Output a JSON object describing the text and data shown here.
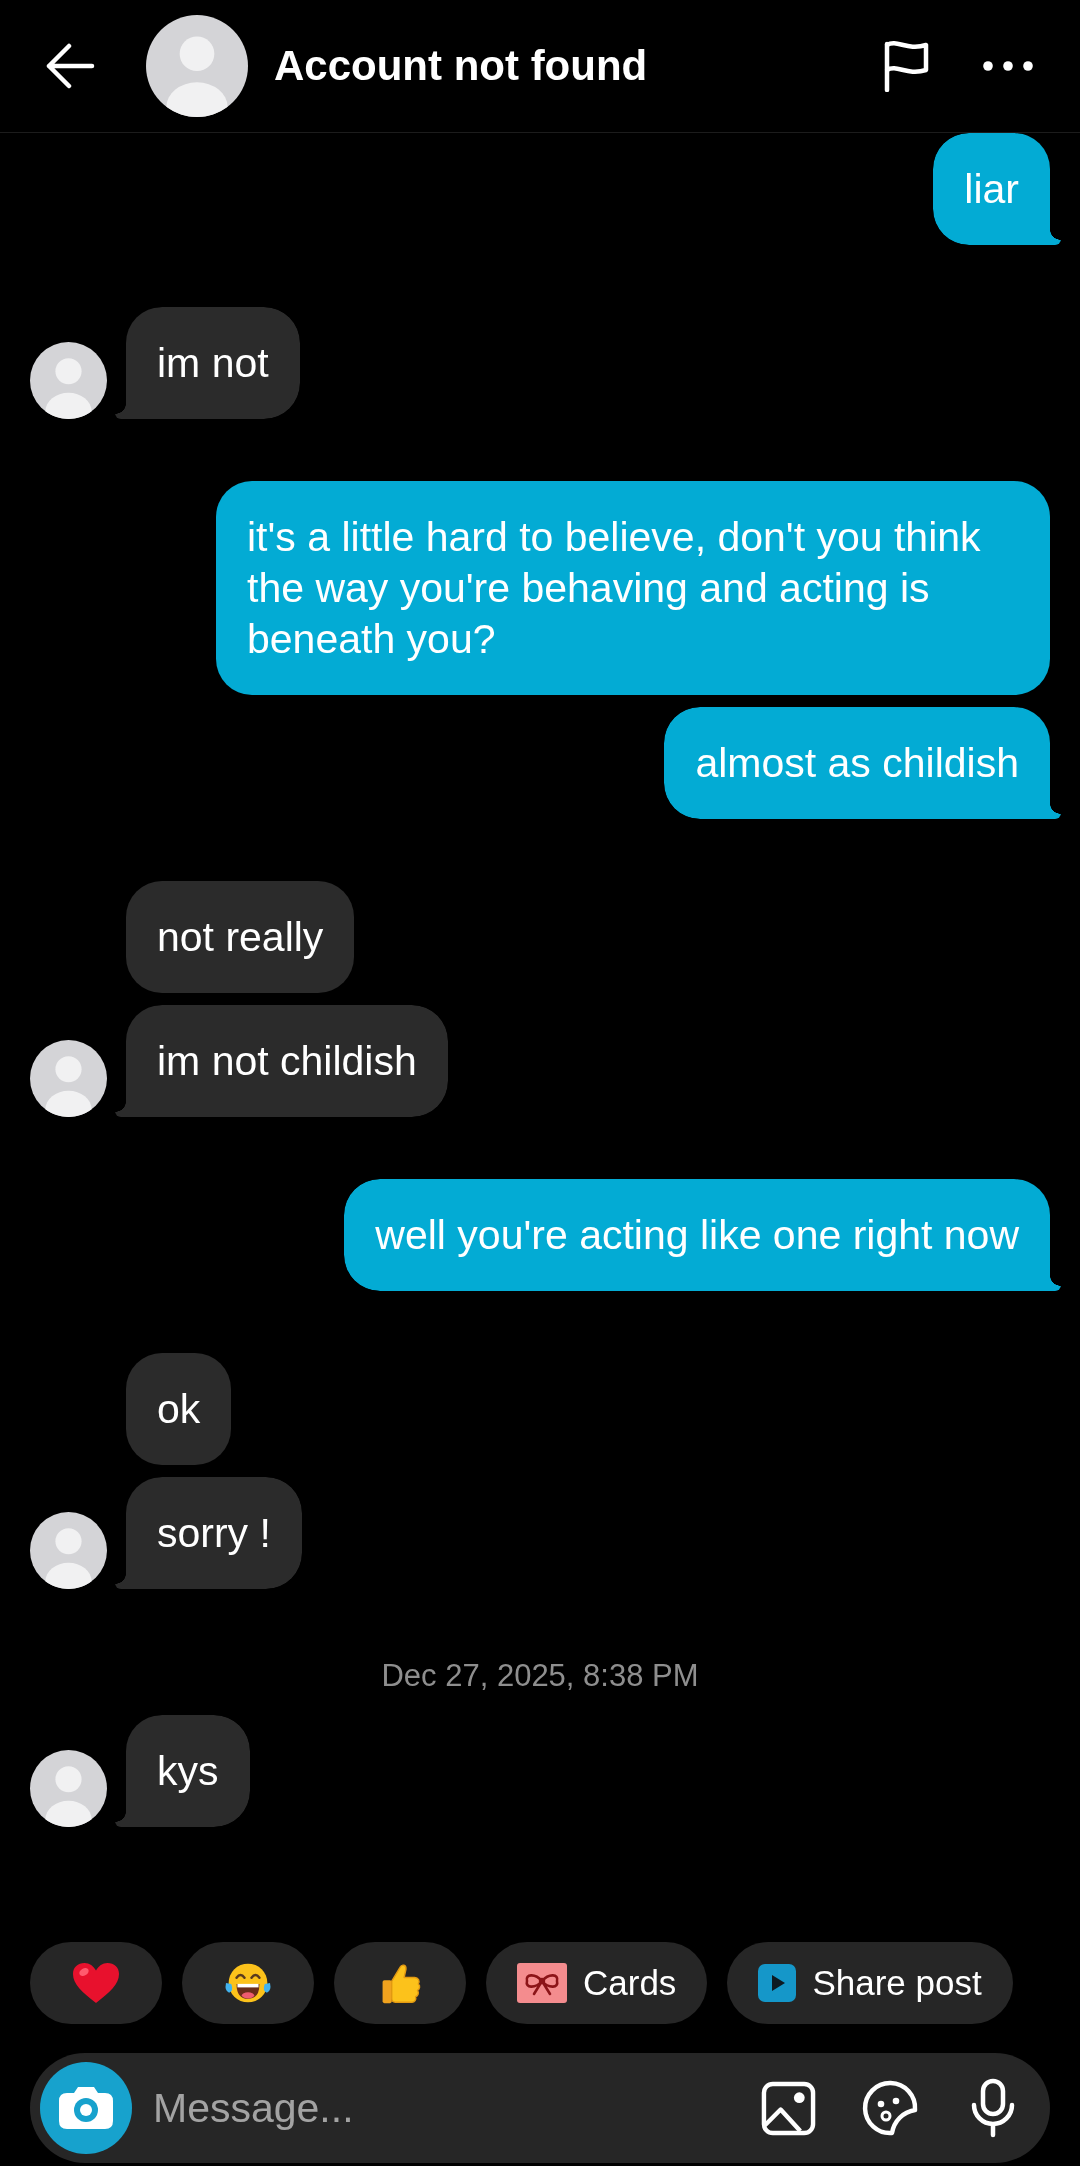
{
  "header": {
    "title": "Account not found"
  },
  "messages": [
    {
      "kind": "sent",
      "text": "liar"
    },
    {
      "kind": "received",
      "text": "im not"
    },
    {
      "kind": "sent",
      "text": "it's a little hard to believe, don't you think the way you're behaving and acting is beneath you?"
    },
    {
      "kind": "sent",
      "text": "almost as childish"
    },
    {
      "kind": "received",
      "text": "not really"
    },
    {
      "kind": "received",
      "text": "im not childish"
    },
    {
      "kind": "sent",
      "text": "well you're acting like one right now"
    },
    {
      "kind": "received",
      "text": "ok"
    },
    {
      "kind": "received",
      "text": "sorry !"
    },
    {
      "kind": "timestamp",
      "text": "Dec 27, 2025, 8:38 PM"
    },
    {
      "kind": "received",
      "text": "kys"
    }
  ],
  "quick_replies": [
    {
      "kind": "heart"
    },
    {
      "kind": "laughing"
    },
    {
      "kind": "thumbs_up"
    },
    {
      "kind": "cards",
      "label": "Cards"
    },
    {
      "kind": "share",
      "label": "Share post"
    }
  ],
  "composer": {
    "placeholder": "Message..."
  }
}
